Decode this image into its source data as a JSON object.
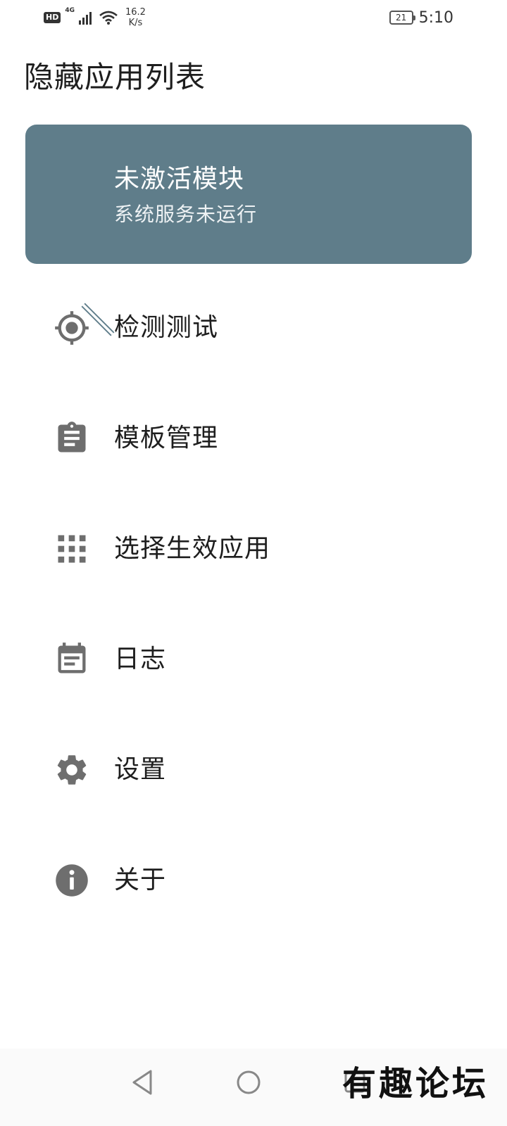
{
  "status_bar": {
    "hd": "HD",
    "network": "4G",
    "speed_value": "16.2",
    "speed_unit": "K/s",
    "battery": "21",
    "time": "5:10"
  },
  "page": {
    "title": "隐藏应用列表"
  },
  "status_card": {
    "title": "未激活模块",
    "subtitle": "系统服务未运行",
    "icon": "extension-off-icon",
    "background": "#5f7d8a"
  },
  "menu": {
    "items": [
      {
        "label": "检测测试",
        "icon": "target-icon"
      },
      {
        "label": "模板管理",
        "icon": "clipboard-icon"
      },
      {
        "label": "选择生效应用",
        "icon": "apps-grid-icon"
      },
      {
        "label": "日志",
        "icon": "event-note-icon"
      },
      {
        "label": "设置",
        "icon": "gear-icon"
      },
      {
        "label": "关于",
        "icon": "info-icon"
      }
    ]
  },
  "nav_bar": {
    "back": "back-icon",
    "home": "home-icon",
    "recents": "recents-icon"
  },
  "watermark": "有趣论坛",
  "colors": {
    "icon": "#6e6e6e",
    "text": "#1e1e1e",
    "card": "#5f7d8a"
  }
}
